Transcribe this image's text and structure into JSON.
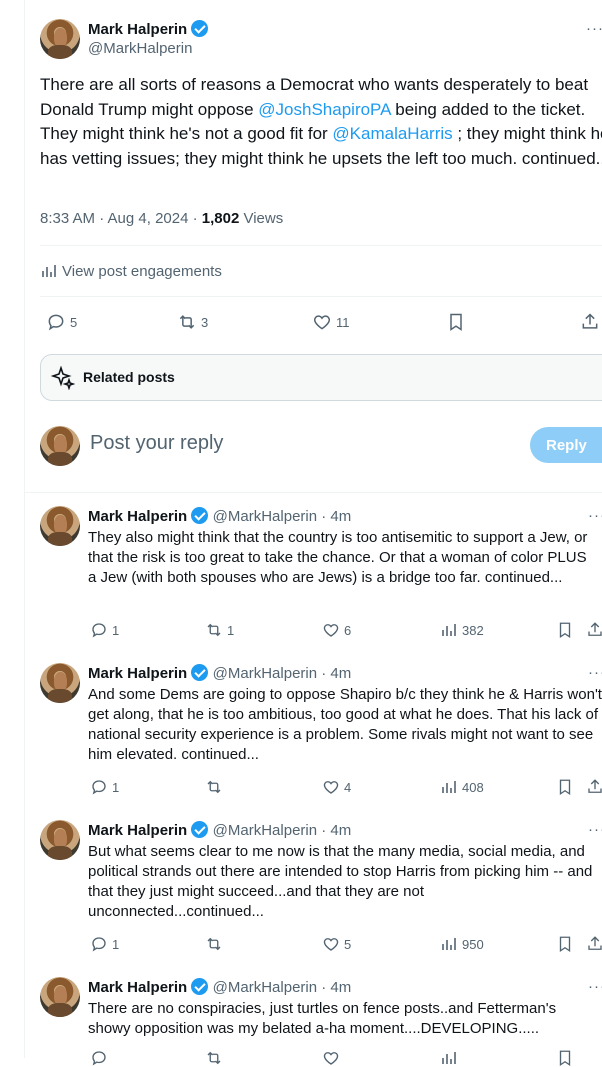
{
  "main_post": {
    "author_name": "Mark Halperin",
    "author_handle": "@MarkHalperin",
    "more": "···",
    "text_part1": "There are all sorts of reasons a Democrat who wants desperately to beat Donald Trump might oppose ",
    "mention1": "@JoshShapiroPA",
    "text_part2": " being added to the ticket. They might think he's not a good fit for ",
    "mention2": "@KamalaHarris",
    "text_part3": " ; they might think he has vetting issues; they might think he upsets the left too much. continued...",
    "time": "8:33 AM · Aug 4, 2024 · ",
    "views_count": "1,802",
    "views_label": " Views",
    "engagements_label": "View post engagements",
    "replies": "5",
    "reposts": "3",
    "likes": "11"
  },
  "related_posts_label": "Related posts",
  "reply_box": {
    "placeholder": "Post your reply",
    "button": "Reply"
  },
  "replies": [
    {
      "name": "Mark Halperin",
      "handle": "@MarkHalperin · 4m",
      "text": "They also might think that the country is too antisemitic to support a Jew, or that the risk is too great to take the chance. Or that a woman of color PLUS a Jew (with both spouses who are Jews) is a bridge too far. continued...",
      "replies": "1",
      "reposts": "1",
      "likes": "6",
      "views": "382"
    },
    {
      "name": "Mark Halperin",
      "handle": "@MarkHalperin · 4m",
      "text": "And some Dems are going to oppose Shapiro b/c they think he & Harris won't get along, that he is too ambitious, too good at what he does. That his lack of national security experience is a problem. Some rivals might not want to see him elevated. continued...",
      "replies": "1",
      "reposts": "",
      "likes": "4",
      "views": "408"
    },
    {
      "name": "Mark Halperin",
      "handle": "@MarkHalperin · 4m",
      "text": "But what seems clear to me now is that the many media, social media, and political strands out there are intended to stop Harris from picking him -- and that they just might succeed...and that they are not unconnected...continued...",
      "replies": "1",
      "reposts": "",
      "likes": "5",
      "views": "950"
    },
    {
      "name": "Mark Halperin",
      "handle": "@MarkHalperin · 4m",
      "text": "There are no conspiracies, just turtles on fence posts..and Fetterman's showy opposition was my belated a-ha moment....DEVELOPING.....",
      "replies": "",
      "reposts": "",
      "likes": "",
      "views": ""
    }
  ],
  "icons": {
    "reply": "reply-icon",
    "repost": "repost-icon",
    "like": "heart-icon",
    "views": "views-icon",
    "bookmark": "bookmark-icon",
    "share": "share-icon",
    "sparkle": "sparkle-icon",
    "verified": "verified-badge-icon"
  },
  "colors": {
    "accent": "#1d9bf0",
    "secondary_text": "#536471",
    "reply_button": "#8ecdf7"
  }
}
